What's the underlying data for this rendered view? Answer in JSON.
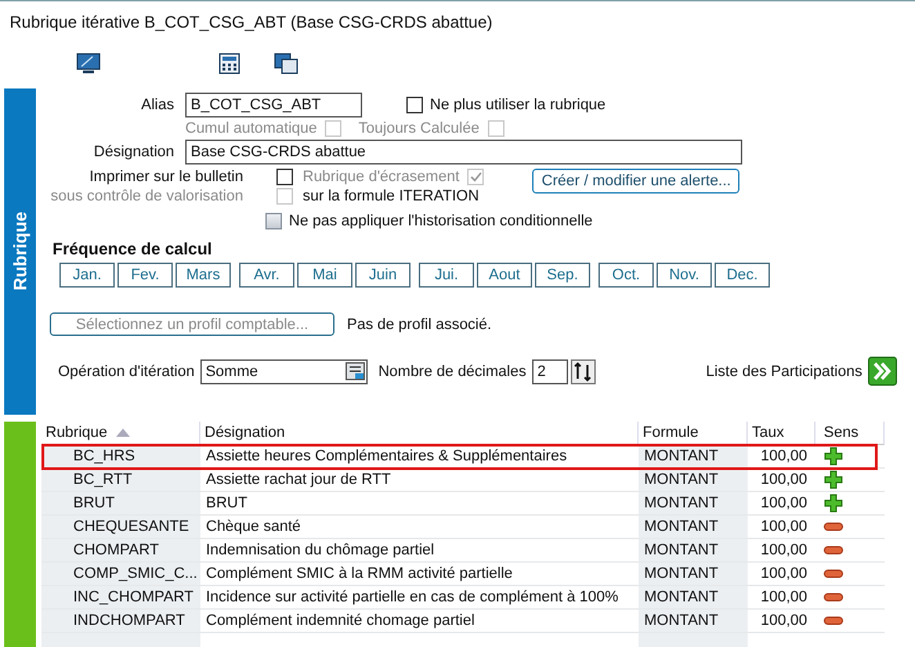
{
  "window": {
    "title": "Rubrique itérative B_COT_CSG_ABT (Base CSG-CRDS abattue)"
  },
  "side_tab": {
    "label": "Rubrique"
  },
  "alias": {
    "label": "Alias",
    "value": "B_COT_CSG_ABT"
  },
  "checkboxes": [
    {
      "label": "Ne plus utiliser la rubrique",
      "checked": false,
      "disabled": false
    },
    {
      "label": "Cumul automatique",
      "checked": false,
      "disabled": true
    },
    {
      "label": "Toujours Calculée",
      "checked": false,
      "disabled": true
    }
  ],
  "designation": {
    "label": "Désignation",
    "value": "Base CSG-CRDS abattue"
  },
  "print": {
    "label": "Imprimer sur le bulletin",
    "checked": false,
    "disabled": false,
    "override_label": "Rubrique d'écrasement",
    "override_checked": true,
    "override_disabled": true
  },
  "control": {
    "label": "sous contrôle de valorisation",
    "checked": false,
    "disabled": true,
    "text": "sur la formule ITERATION"
  },
  "alert_button": "Créer / modifier une alerte...",
  "history": {
    "label": "Ne pas appliquer l'historisation conditionnelle",
    "checked": false
  },
  "frequency": {
    "title": "Fréquence de calcul",
    "quarters": [
      {
        "months": [
          "Jan.",
          "Fev.",
          "Mars"
        ]
      },
      {
        "months": [
          "Avr.",
          "Mai",
          "Juin"
        ]
      },
      {
        "months": [
          "Jui.",
          "Aout",
          "Sep."
        ]
      },
      {
        "months": [
          "Oct.",
          "Nov.",
          "Dec."
        ]
      }
    ]
  },
  "profile": {
    "button": "Sélectionnez un profil comptable...",
    "status": "Pas de profil associé."
  },
  "operation": {
    "label": "Opération d'itération",
    "value": "Somme"
  },
  "decimals": {
    "label": "Nombre de décimales",
    "value": "2"
  },
  "participations": {
    "label": "Liste des Participations"
  },
  "table": {
    "columns": [
      "Rubrique",
      "Désignation",
      "Formule",
      "Taux",
      "Sens"
    ],
    "rows": [
      {
        "code": "BC_HRS",
        "designation": "Assiette heures Complémentaires & Supplémentaires",
        "formula": "MONTANT",
        "rate": "100,00",
        "kind": "plus",
        "highlighted": true
      },
      {
        "code": "BC_RTT",
        "designation": "Assiette rachat jour de RTT",
        "formula": "MONTANT",
        "rate": "100,00",
        "kind": "plus",
        "highlighted": false
      },
      {
        "code": "BRUT",
        "designation": "BRUT",
        "formula": "MONTANT",
        "rate": "100,00",
        "kind": "plus",
        "highlighted": false
      },
      {
        "code": "CHEQUESANTE",
        "designation": "Chèque santé",
        "formula": "MONTANT",
        "rate": "100,00",
        "kind": "minus",
        "highlighted": false
      },
      {
        "code": "CHOMPART",
        "designation": "Indemnisation du chômage partiel",
        "formula": "MONTANT",
        "rate": "100,00",
        "kind": "minus",
        "highlighted": false
      },
      {
        "code": "COMP_SMIC_C...",
        "designation": "Complément SMIC à la RMM activité partielle",
        "formula": "MONTANT",
        "rate": "100,00",
        "kind": "minus",
        "highlighted": false
      },
      {
        "code": "INC_CHOMPART",
        "designation": "Incidence sur activité partielle en cas de complément à 100%",
        "formula": "MONTANT",
        "rate": "100,00",
        "kind": "minus",
        "highlighted": false
      },
      {
        "code": "INDCHOMPART",
        "designation": "Complément indemnité chomage partiel",
        "formula": "MONTANT",
        "rate": "100,00",
        "kind": "minus",
        "highlighted": false
      }
    ]
  }
}
